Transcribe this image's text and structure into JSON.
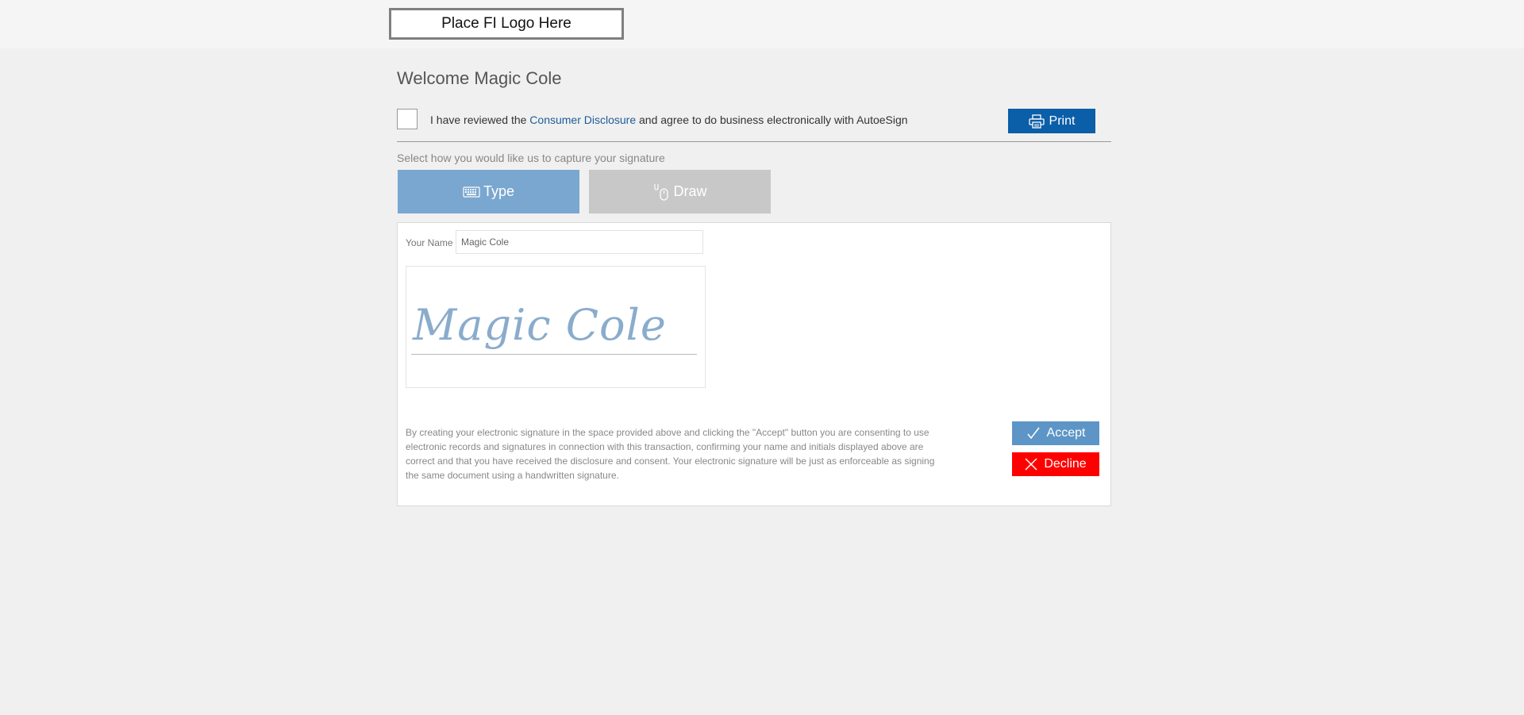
{
  "header": {
    "logo_text": "Place FI Logo Here"
  },
  "welcome": {
    "title": "Welcome Magic Cole"
  },
  "agreement": {
    "text_before": "I have reviewed the ",
    "link_text": "Consumer Disclosure",
    "text_after": " and agree to do business electronically with AutoeSign",
    "checked": false
  },
  "print": {
    "label": "Print",
    "icon": "printer-icon"
  },
  "capture": {
    "instruction": "Select how you would like us to capture your signature",
    "tabs": [
      {
        "label": "Type",
        "icon": "keyboard-icon",
        "active": true
      },
      {
        "label": "Draw",
        "icon": "mouse-icon",
        "active": false
      }
    ]
  },
  "form": {
    "name_label": "Your Name",
    "name_value": "Magic Cole",
    "signature_text": "Magic Cole"
  },
  "consent": {
    "text": "By creating your electronic signature in the space provided above and clicking the \"Accept\" button you are consenting to use electronic records and signatures in connection with this transaction, confirming your name and initials displayed above are correct and that you have received the disclosure and consent. Your electronic signature will be just as enforceable as signing the same document using a handwritten signature."
  },
  "actions": {
    "accept_label": "Accept",
    "accept_icon": "checkmark-icon",
    "decline_label": "Decline",
    "decline_icon": "x-icon"
  },
  "colors": {
    "print_button": "#0b5ea8",
    "type_tab": "#7aa7cf",
    "draw_tab": "#c8c8c8",
    "accept_button": "#5d95c6",
    "decline_button": "#ff0000",
    "link": "#1f5c99",
    "signature": "#8aaccc"
  }
}
